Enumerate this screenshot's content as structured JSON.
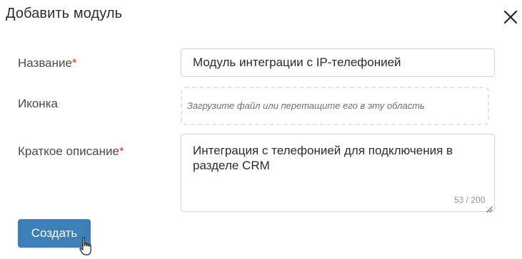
{
  "dialog": {
    "title": "Добавить модуль",
    "close_icon": "close-icon"
  },
  "form": {
    "name": {
      "label": "Название",
      "required_mark": "*",
      "value": "Модуль интеграции с IP-телефонией"
    },
    "icon": {
      "label": "Иконка",
      "dropzone_text": "Загрузите файл или перетащите его в эту область"
    },
    "description": {
      "label": "Краткое описание",
      "required_mark": "*",
      "value": "Интеграция с телефонией для подключения в разделе CRM",
      "counter": "53 / 200"
    }
  },
  "actions": {
    "create_label": "Создать"
  },
  "colors": {
    "primary_button": "#3d7fb6",
    "required": "#e0322d"
  },
  "cursor_icon": "hand-pointer-icon"
}
